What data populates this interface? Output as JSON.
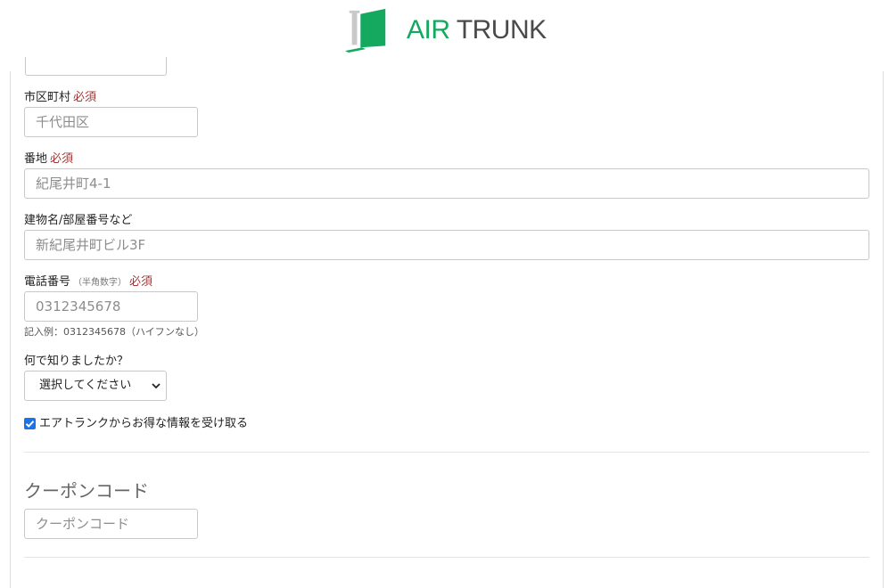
{
  "brand": {
    "air": "AIR",
    "trunk": "TRUNK",
    "green": "#15a85f",
    "dark": "#4a4a4a"
  },
  "required_label": "必須",
  "form": {
    "city": {
      "label": "市区町村",
      "placeholder": "千代田区"
    },
    "street": {
      "label": "番地",
      "placeholder": "紀尾井町4-1"
    },
    "building": {
      "label": "建物名/部屋番号など",
      "placeholder": "新紀尾井町ビル3F"
    },
    "phone": {
      "label": "電話番号",
      "note": "（半角数字）",
      "placeholder": "0312345678",
      "helper": "記入例：0312345678（ハイフンなし）"
    },
    "referral": {
      "label": "何で知りましたか？",
      "selected": "選択してください"
    },
    "newsletter": {
      "label": "エアトランクからお得な情報を受け取る",
      "checked": true
    }
  },
  "coupon": {
    "title": "クーポンコード",
    "placeholder": "クーポンコード"
  }
}
